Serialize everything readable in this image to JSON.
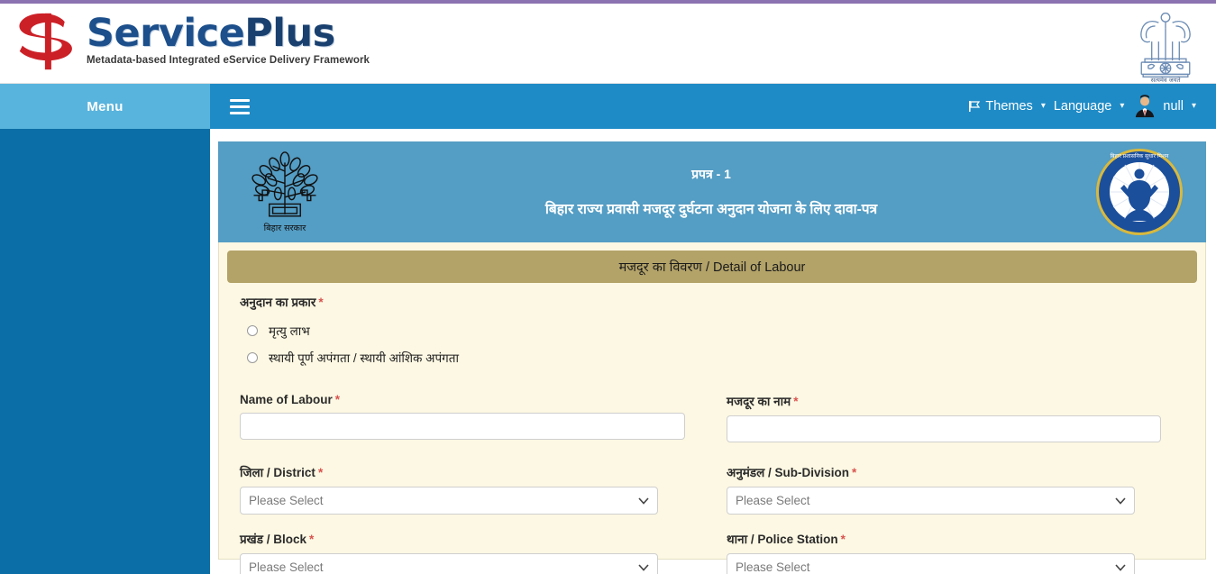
{
  "brand": {
    "title_service": "Service",
    "title_plus": "Plus",
    "tagline": "Metadata-based Integrated eService Delivery Framework",
    "emblem_caption": "सत्यमेव जयते"
  },
  "nav": {
    "menu_label": "Menu",
    "themes_label": "Themes",
    "language_label": "Language",
    "user_label": "null",
    "caret": "▾"
  },
  "banner": {
    "form_number": "प्रपत्र - 1",
    "scheme_title": "बिहार राज्य प्रवासी मजदूर दुर्घटना अनुदान योजना के लिए दावा-पत्र",
    "emblem_caption": "बिहार सरकार",
    "logo_caption": "बिहार प्रशासनिक सुधार मिशन"
  },
  "form": {
    "section_title": "मजदूर का विवरण / Detail of Labour",
    "grant_type": {
      "label": "अनुदान का प्रकार",
      "required": "*",
      "options": [
        {
          "label": "मृत्यु लाभ",
          "selected": false
        },
        {
          "label": "स्थायी पूर्ण अपंगता / स्थायी आंशिक अपंगता",
          "selected": false
        }
      ]
    },
    "fields": [
      {
        "name": "name_of_labour",
        "label": "Name of Labour",
        "required": "*",
        "type": "text",
        "value": "",
        "placeholder": ""
      },
      {
        "name": "majdoor_ka_naam",
        "label": "मजदूर का नाम",
        "required": "*",
        "type": "text",
        "value": "",
        "placeholder": ""
      },
      {
        "name": "district",
        "label": "जिला / District",
        "required": "*",
        "type": "select",
        "value": "Please Select"
      },
      {
        "name": "sub_division",
        "label": "अनुमंडल / Sub-Division",
        "required": "*",
        "type": "select",
        "value": "Please Select"
      },
      {
        "name": "block",
        "label": "प्रखंड / Block",
        "required": "*",
        "type": "select",
        "value": "Please Select"
      },
      {
        "name": "police_station",
        "label": "थाना / Police Station",
        "required": "*",
        "type": "select",
        "value": "Please Select"
      }
    ]
  },
  "colors": {
    "top_rule": "#8b72b0",
    "nav_bar": "#1f8bc6",
    "menu_tab": "#59b4dd",
    "sidebar": "#0b6ea6",
    "banner": "#549dc4",
    "panel_bg": "#fdf8e3",
    "section_head": "#b3a369",
    "brand_blue": "#1c4f8b",
    "brand_red": "#cc2027",
    "required_red": "#d9534f"
  }
}
